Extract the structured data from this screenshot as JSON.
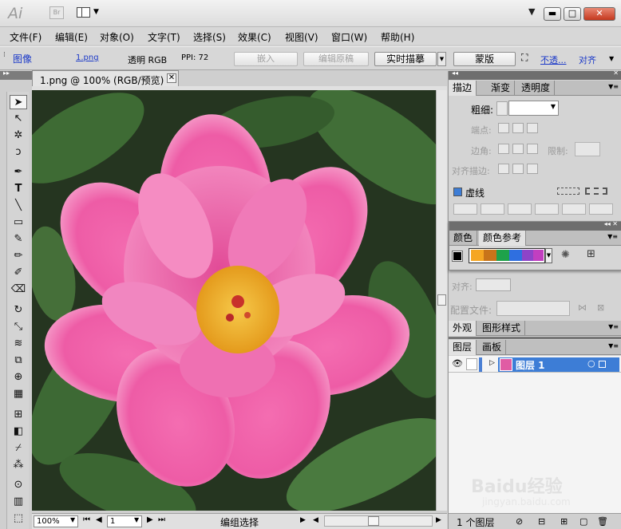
{
  "app": {
    "logo": "Ai",
    "bridge": "Br"
  },
  "menus": [
    "文件(F)",
    "编辑(E)",
    "对象(O)",
    "文字(T)",
    "选择(S)",
    "效果(C)",
    "视图(V)",
    "窗口(W)",
    "帮助(H)"
  ],
  "control": {
    "object_type": "图像",
    "file_link": "1.png",
    "mode": "透明 RGB",
    "ppi": "PPI: 72",
    "embed": "嵌入",
    "edit_original": "编辑原稿",
    "live_trace": "实时描摹",
    "mask": "蒙版",
    "opacity_link": "不透...",
    "align_link": "对齐"
  },
  "document": {
    "tab_label": "1.png @ 100% (RGB/预览)",
    "zoom": "100%",
    "artboard": "1",
    "status_text": "编组选择"
  },
  "stroke_panel": {
    "tabs": [
      "描边",
      "渐变",
      "透明度"
    ],
    "weight_label": "粗细:",
    "cap_label": "端点:",
    "corner_label": "边角:",
    "limit_label": "限制:",
    "align_label": "对齐描边:",
    "dashed_label": "虚线"
  },
  "color_panel": {
    "tabs": [
      "颜色",
      "颜色参考"
    ]
  },
  "colors": {
    "swatch1": "#f5a623",
    "swatch2": "#c8741a",
    "swatch3": "#1ea24a",
    "swatch4": "#2f6fe0",
    "swatch5": "#8e44c8",
    "swatch6": "#c23fc0",
    "accent": "#3d7dd6"
  },
  "misc_panel": {
    "align_label": "对齐:",
    "profile_label": "配置文件:"
  },
  "appearance_panel": {
    "tabs": [
      "外观",
      "图形样式"
    ]
  },
  "layers_panel": {
    "tabs": [
      "图层",
      "画板"
    ],
    "layer_name": "图层 1",
    "footer": "1 个图层"
  },
  "watermark": {
    "brand": "Baidu经验",
    "url": "jingyan.baidu.com"
  }
}
